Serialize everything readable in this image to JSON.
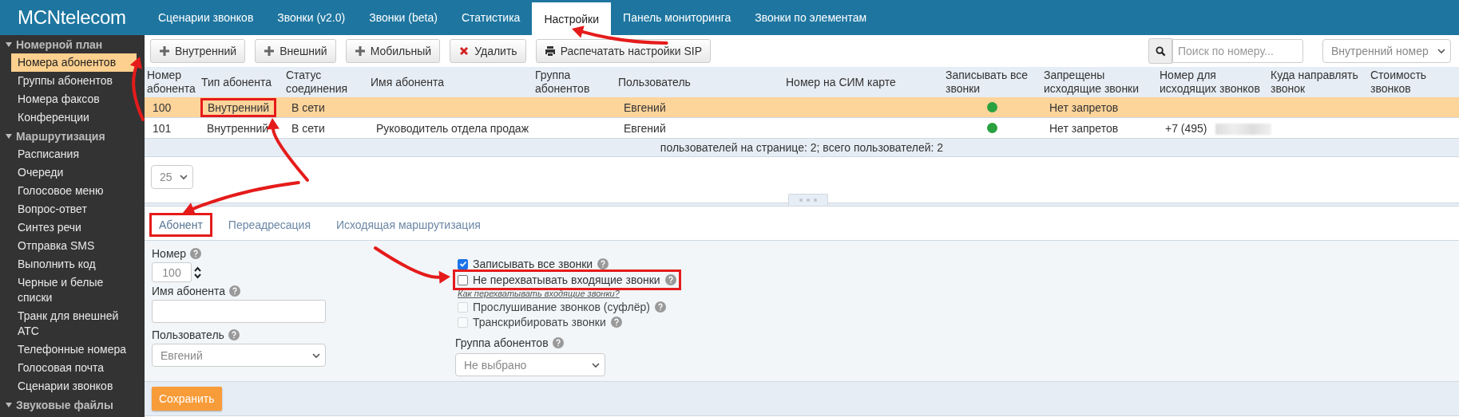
{
  "logo": "MCNtelecom",
  "nav": [
    {
      "label": "Сценарии звонков",
      "selected": false,
      "arrow": false
    },
    {
      "label": "Звонки (v2.0)",
      "selected": false,
      "arrow": false
    },
    {
      "label": "Звонки (beta)",
      "selected": false,
      "arrow": false
    },
    {
      "label": "Статистика",
      "selected": false,
      "arrow": false
    },
    {
      "label": "Настройки",
      "selected": true,
      "arrow": true
    },
    {
      "label": "Панель мониторинга",
      "selected": false,
      "arrow": false
    },
    {
      "label": "Звонки по элементам",
      "selected": false,
      "arrow": false
    }
  ],
  "sidebar": {
    "groups": [
      {
        "label": "Номерной план",
        "expanded": true,
        "items": [
          {
            "label": "Номера абонентов",
            "selected": true,
            "arrow": true
          },
          {
            "label": "Группы абонентов",
            "selected": false,
            "arrow": false
          },
          {
            "label": "Номера факсов",
            "selected": false,
            "arrow": false
          },
          {
            "label": "Конференции",
            "selected": false,
            "arrow": false
          }
        ]
      },
      {
        "label": "Маршрутизация",
        "expanded": true,
        "items": [
          {
            "label": "Расписания",
            "selected": false,
            "arrow": false
          },
          {
            "label": "Очереди",
            "selected": false,
            "arrow": false
          },
          {
            "label": "Голосовое меню",
            "selected": false,
            "arrow": false
          },
          {
            "label": "Вопрос-ответ",
            "selected": false,
            "arrow": false
          },
          {
            "label": "Синтез речи",
            "selected": false,
            "arrow": false
          },
          {
            "label": "Отправка SMS",
            "selected": false,
            "arrow": false
          },
          {
            "label": "Выполнить код",
            "selected": false,
            "arrow": false
          },
          {
            "label": "Черные и белые списки",
            "selected": false,
            "arrow": false
          },
          {
            "label": "Транк для внешней АТС",
            "selected": false,
            "arrow": false
          },
          {
            "label": "Телефонные номера",
            "selected": false,
            "arrow": false
          },
          {
            "label": "Голосовая почта",
            "selected": false,
            "arrow": false
          },
          {
            "label": "Сценарии звонков",
            "selected": false,
            "arrow": false
          }
        ]
      },
      {
        "label": "Звуковые файлы",
        "expanded": true
      }
    ]
  },
  "toolbar": {
    "buttons": [
      {
        "label": "Внутренний",
        "kind": "add"
      },
      {
        "label": "Внешний",
        "kind": "add"
      },
      {
        "label": "Мобильный",
        "kind": "add"
      },
      {
        "label": "Удалить",
        "kind": "delete"
      },
      {
        "label": "Распечатать настройки SIP",
        "kind": "print"
      }
    ],
    "search": {
      "placeholder": "Поиск по номеру..."
    },
    "filter": {
      "value": "Внутренний номер"
    }
  },
  "table": {
    "columns": [
      "Номер абонента",
      "Тип абонента",
      "Статус соединения",
      "Имя абонента",
      "Группа абонентов",
      "Пользователь",
      "Номер на СИМ карте",
      "Записывать все звонки",
      "Запрещены исходящие звонки",
      "Номер для исходящих звонков",
      "Куда направлять звонок",
      "Стоимость звонков"
    ],
    "rows": [
      {
        "selected": true,
        "number": "100",
        "type": "Внутренний",
        "type_highlighted": true,
        "status": "В сети",
        "user": "Евгений",
        "record": true,
        "restrictions": "Нет запретов",
        "outgoing_hidden": false
      },
      {
        "selected": false,
        "number": "101",
        "type": "Внутренний",
        "type_highlighted": false,
        "status": "В сети",
        "name": "Руководитель отдела продаж",
        "user": "Евгений",
        "record": true,
        "restrictions": "Нет запретов",
        "outgoing": "+7 (495)",
        "outgoing_hidden": true
      }
    ],
    "footer": "пользователей на странице: 2; всего пользователей: 2",
    "page_size": "25"
  },
  "detail_tabs": [
    {
      "label": "Абонент",
      "selected": true,
      "highlighted": true
    },
    {
      "label": "Переадресация",
      "selected": false,
      "highlighted": false
    },
    {
      "label": "Исходящая маршрутизация",
      "selected": false,
      "highlighted": false
    }
  ],
  "form": {
    "number": {
      "label": "Номер",
      "value": "100"
    },
    "name": {
      "label": "Имя абонента"
    },
    "user": {
      "label": "Пользователь",
      "value": "Евгений"
    },
    "checks": [
      {
        "label": "Записывать все звонки",
        "checked": true,
        "disabled": false,
        "highlighted": false
      },
      {
        "label": "Не перехватывать входящие звонки",
        "checked": false,
        "disabled": false,
        "highlighted": true,
        "link": "Как перехватывать входящие звонки?"
      },
      {
        "label": "Прослушивание звонков (суфлёр)",
        "checked": false,
        "disabled": true,
        "highlighted": false
      },
      {
        "label": "Транскрибировать звонки",
        "checked": false,
        "disabled": true,
        "highlighted": false
      }
    ],
    "group": {
      "label": "Группа абонентов",
      "value": "Не выбрано"
    }
  },
  "save_button": "Сохранить"
}
